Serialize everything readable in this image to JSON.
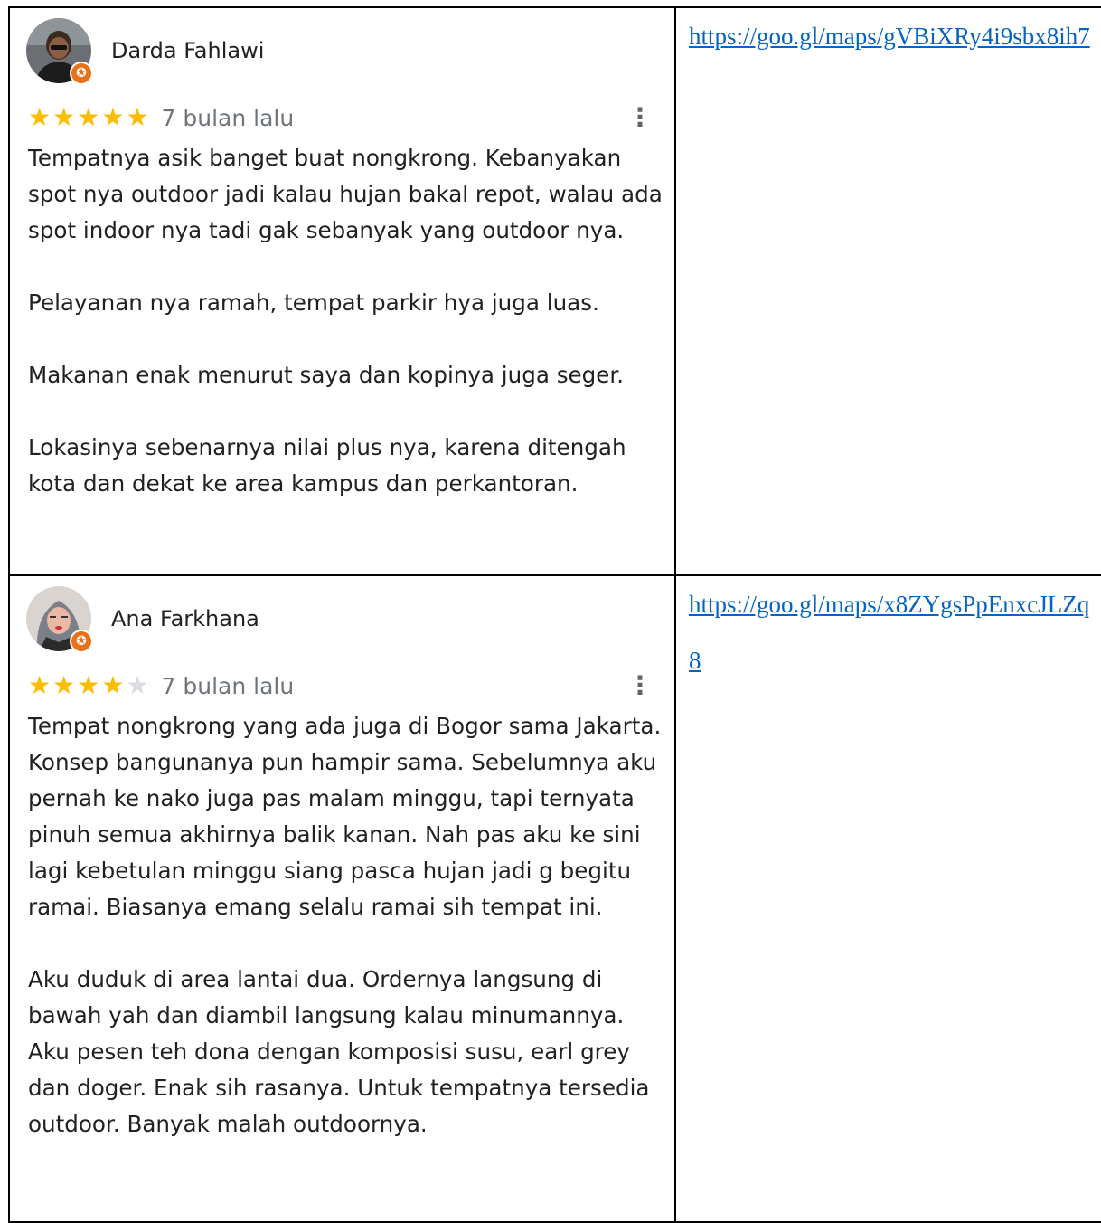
{
  "reviews": [
    {
      "name": "Darda Fahlawi",
      "rating": 5,
      "max_rating": 5,
      "date": "7 bulan lalu",
      "more_icon": "more-vert-icon",
      "paragraphs": [
        "Tempatnya asik banget buat nongkrong. Kebanyakan spot nya outdoor jadi kalau hujan bakal repot, walau ada spot indoor nya tadi gak sebanyak yang outdoor nya.",
        "Pelayanan nya ramah, tempat parkir hya juga luas.",
        "Makanan enak menurut saya dan kopinya juga seger.",
        "Lokasinya sebenarnya nilai plus nya, karena ditengah kota dan dekat ke area kampus dan perkantoran."
      ],
      "link": "https://goo.gl/maps/gVBiXRy4i9sbx8ih7"
    },
    {
      "name": "Ana Farkhana",
      "rating": 4,
      "max_rating": 5,
      "date": "7 bulan lalu",
      "more_icon": "more-vert-icon",
      "paragraphs": [
        "Tempat nongkrong yang ada juga di Bogor sama Jakarta. Konsep bangunanya pun hampir sama. Sebelumnya aku pernah ke nako juga pas malam minggu, tapi ternyata pinuh semua akhirnya balik kanan. Nah pas aku ke sini lagi kebetulan minggu siang pasca hujan jadi g begitu ramai. Biasanya emang selalu ramai sih tempat ini.",
        "Aku duduk di area lantai dua. Ordernya langsung di bawah yah dan diambil langsung kalau minumannya. Aku pesen teh dona dengan komposisi susu, earl grey dan doger. Enak sih rasanya. Untuk tempatnya tersedia outdoor. Banyak malah outdoornya."
      ],
      "link": "https://goo.gl/maps/x8ZYgsPpEnxcJLZq8"
    }
  ],
  "colors": {
    "star_on": "#fbbc04",
    "star_off": "#dadce0",
    "link": "#0563c1",
    "badge": "#e8711a"
  }
}
